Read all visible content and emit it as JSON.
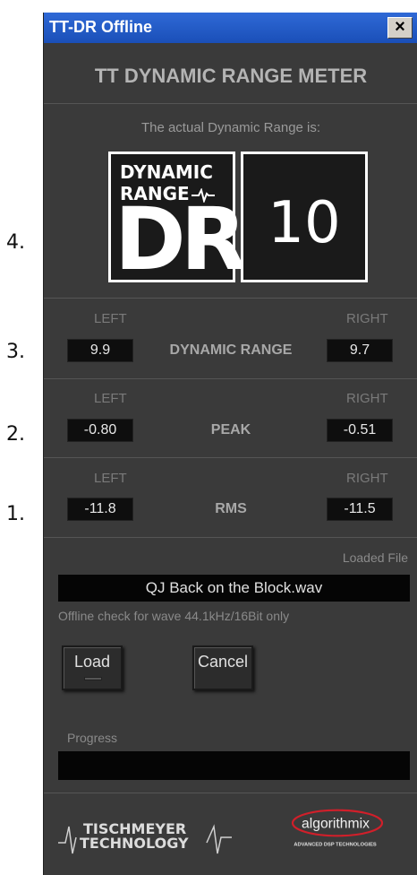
{
  "margin_numbers": [
    "4.",
    "3.",
    "2.",
    "1."
  ],
  "window": {
    "title": "TT-DR Offline",
    "close_label": "×"
  },
  "meter_title": "TT DYNAMIC RANGE METER",
  "dr_caption": "The actual Dynamic Range is:",
  "dr_logo": {
    "line1": "DYNAMIC",
    "line2": "RANGE",
    "line3": "DR"
  },
  "dr_value": "10",
  "rows": {
    "dynamic_range": {
      "left_label": "LEFT",
      "right_label": "RIGHT",
      "name": "DYNAMIC RANGE",
      "left_value": "9.9",
      "right_value": "9.7"
    },
    "peak": {
      "left_label": "LEFT",
      "right_label": "RIGHT",
      "name": "PEAK",
      "left_value": "-0.80",
      "right_value": "-0.51"
    },
    "rms": {
      "left_label": "LEFT",
      "right_label": "RIGHT",
      "name": "RMS",
      "left_value": "-11.8",
      "right_value": "-11.5"
    }
  },
  "file": {
    "label": "Loaded File",
    "name": "QJ Back on the Block.wav",
    "note": "Offline check for wave 44.1kHz/16Bit only"
  },
  "buttons": {
    "load": "Load",
    "cancel": "Cancel"
  },
  "progress": {
    "label": "Progress",
    "value": 0
  },
  "footer": {
    "tisch_line1": "TISCHMEYER",
    "tisch_line2": "TECHNOLOGY",
    "algo_name": "algorithmix",
    "algo_sub": "ADVANCED DSP TECHNOLOGIES"
  },
  "colors": {
    "titlebar": "#2458c8",
    "panel": "#3a3a3a",
    "algo_accent": "#d11f2a"
  }
}
